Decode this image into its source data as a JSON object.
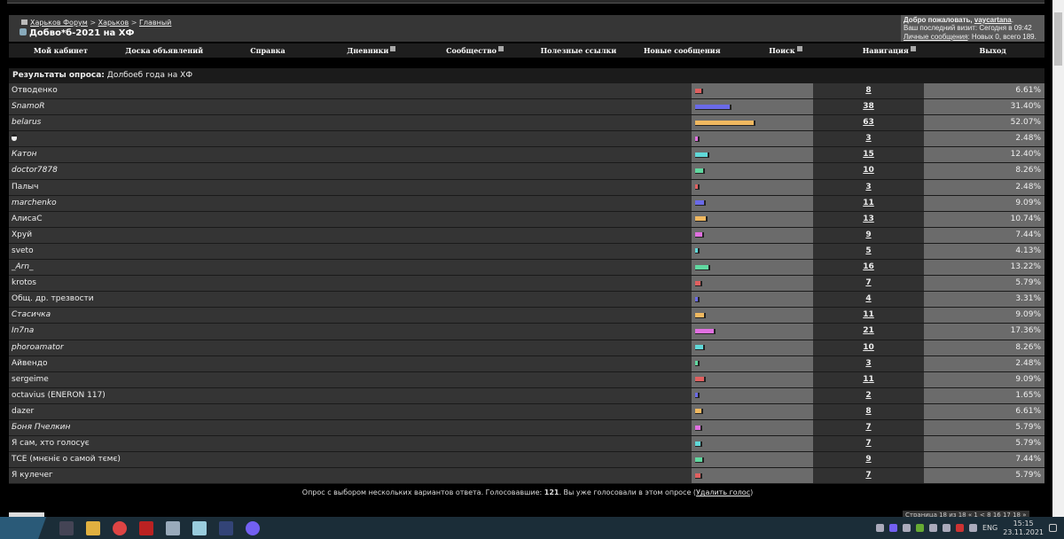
{
  "breadcrumb": [
    "Харьков Форум",
    "Харьков",
    "Главный"
  ],
  "thread_title": "Добво*б-2021 на ХФ",
  "welcome": {
    "greeting": "Добро пожаловать,",
    "username": "vaycartana",
    "last_visit": "Ваш последний визит: Сегодня в 09:42",
    "pm_link": "Личные сообщения",
    "pm_info": ": Новых 0, всего 189."
  },
  "nav": [
    "Мой кабинет",
    "Доска объявлений",
    "Справка",
    "Дневники",
    "Сообщество",
    "Полезные ссылки",
    "Новые сообщения",
    "Поиск",
    "Навигация",
    "Выход"
  ],
  "nav_dropdown": [
    false,
    false,
    false,
    true,
    true,
    false,
    false,
    true,
    true,
    false
  ],
  "poll": {
    "header_label": "Результаты опроса:",
    "question": "Долбоеб года на ХФ",
    "bar_colors": [
      "#e06060",
      "#6a6ae8",
      "#f0b860",
      "#e070e0",
      "#60d8d8",
      "#60d8a0"
    ],
    "options": [
      {
        "label": "Отводенко",
        "italic": false,
        "votes": "8",
        "percent": "6.61%"
      },
      {
        "label": "SnamoR",
        "italic": true,
        "votes": "38",
        "percent": "31.40%"
      },
      {
        "label": "belarus",
        "italic": true,
        "votes": "63",
        "percent": "52.07%"
      },
      {
        "label": "",
        "icon": "penguin-icon",
        "italic": false,
        "votes": "3",
        "percent": "2.48%"
      },
      {
        "label": "Катон",
        "italic": true,
        "votes": "15",
        "percent": "12.40%"
      },
      {
        "label": "doctor7878",
        "italic": true,
        "votes": "10",
        "percent": "8.26%"
      },
      {
        "label": "Палыч",
        "italic": false,
        "votes": "3",
        "percent": "2.48%"
      },
      {
        "label": "marchenko",
        "italic": true,
        "votes": "11",
        "percent": "9.09%"
      },
      {
        "label": "АлисаС",
        "italic": false,
        "votes": "13",
        "percent": "10.74%"
      },
      {
        "label": "Хруй",
        "italic": false,
        "votes": "9",
        "percent": "7.44%"
      },
      {
        "label": "sveto",
        "italic": false,
        "votes": "5",
        "percent": "4.13%"
      },
      {
        "label": "_Arn_",
        "italic": true,
        "votes": "16",
        "percent": "13.22%"
      },
      {
        "label": "krotos",
        "italic": false,
        "votes": "7",
        "percent": "5.79%"
      },
      {
        "label": "Общ. др. трезвости",
        "italic": false,
        "votes": "4",
        "percent": "3.31%"
      },
      {
        "label": "Стасичка",
        "italic": true,
        "votes": "11",
        "percent": "9.09%"
      },
      {
        "label": "In7na",
        "italic": true,
        "votes": "21",
        "percent": "17.36%"
      },
      {
        "label": "phoroamator",
        "italic": true,
        "votes": "10",
        "percent": "8.26%"
      },
      {
        "label": "Айвендо",
        "italic": false,
        "votes": "3",
        "percent": "2.48%"
      },
      {
        "label": "sergeime",
        "italic": false,
        "votes": "11",
        "percent": "9.09%"
      },
      {
        "label": "octavius (ENERON 117)",
        "italic": false,
        "votes": "2",
        "percent": "1.65%"
      },
      {
        "label": "dazer",
        "italic": false,
        "votes": "8",
        "percent": "6.61%"
      },
      {
        "label": "Боня Пчелкин",
        "italic": true,
        "votes": "7",
        "percent": "5.79%"
      },
      {
        "label": "Я сам, хто голосує",
        "italic": false,
        "votes": "7",
        "percent": "5.79%"
      },
      {
        "label": "ТСЕ (мнєніє о самой тємє)",
        "italic": false,
        "votes": "9",
        "percent": "7.44%"
      },
      {
        "label": "Я кулечег",
        "italic": false,
        "votes": "7",
        "percent": "5.79%"
      }
    ],
    "footer_text": "Опрос с выбором нескольких вариантов ответа. Голосовавшие: ",
    "total_voters": "121",
    "footer_text2": ". Вы уже голосовали в этом опросе (",
    "delete_vote": "Удалить голос",
    "footer_close": ")"
  },
  "pager": "Страница 18 из 18  « 1  <  8  16  17  18  »",
  "taskbar": {
    "lang": "ENG",
    "time": "15:15",
    "date": "23.11.2021"
  }
}
